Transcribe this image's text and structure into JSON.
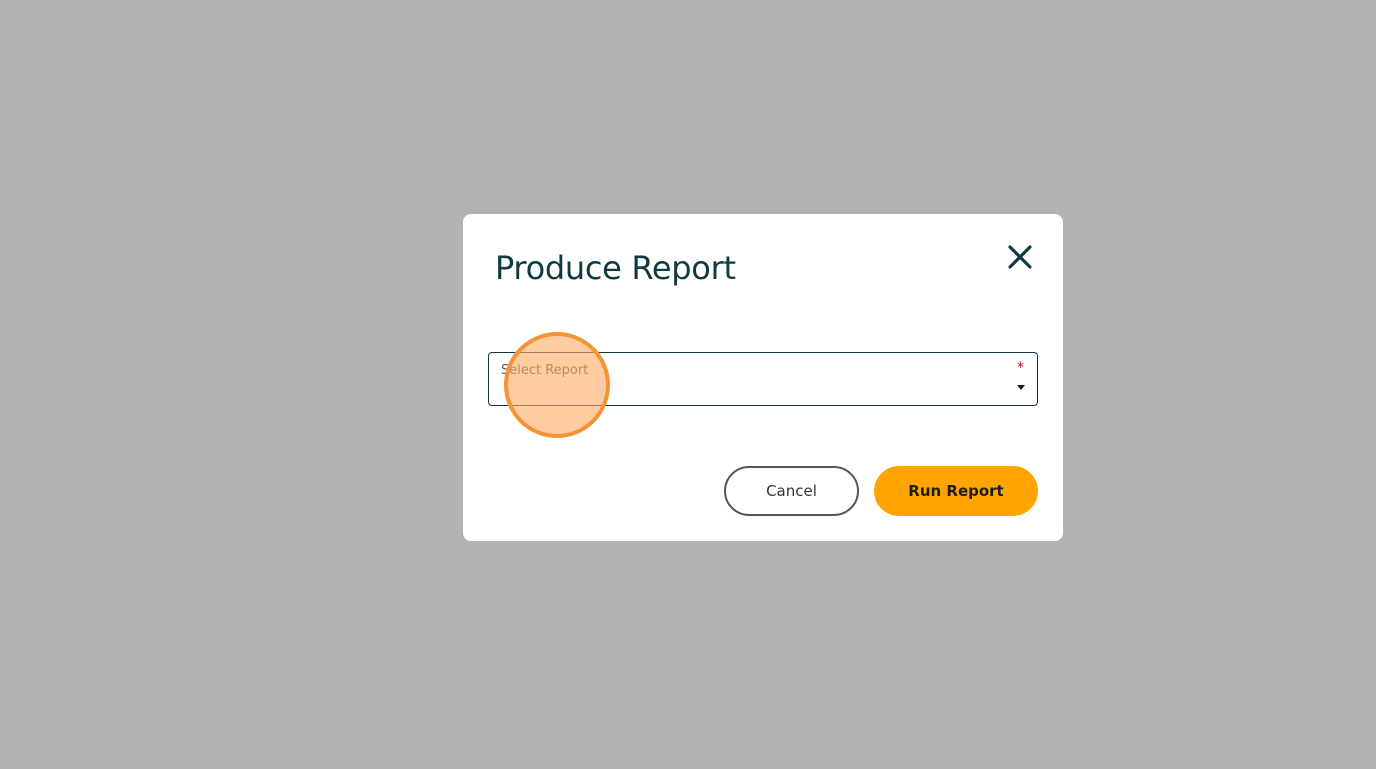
{
  "dialog": {
    "title": "Produce Report",
    "close_icon": "close-icon",
    "select": {
      "label": "Select Report",
      "required_marker": "*",
      "arrow_icon": "dropdown-arrow-icon"
    },
    "buttons": {
      "cancel_label": "Cancel",
      "run_label": "Run Report"
    }
  },
  "colors": {
    "backdrop": "#b2b2b2",
    "title_text": "#0f3a40",
    "primary_button": "#ffa400",
    "required_marker": "#d0112b",
    "click_indicator": "#f39437"
  }
}
